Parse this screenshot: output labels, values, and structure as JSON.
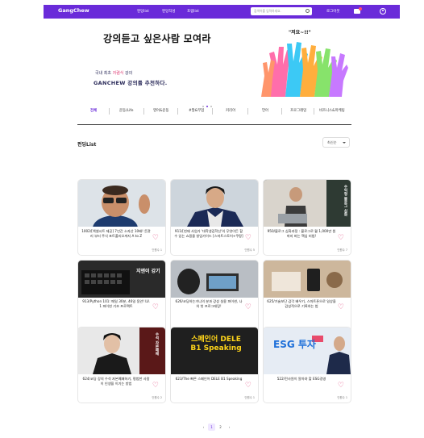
{
  "nav": {
    "logo": "GangChew",
    "links": [
      "펀딩list",
      "펀딩작성",
      "포럼list"
    ],
    "search_placeholder": "검색어를 입력하세요.",
    "login": "로그아웃"
  },
  "banner": {
    "title": "강의듣고 싶은사람 모여라",
    "line1_pre": "국내 최초",
    "line1_hl": "저렴식",
    "line1_post": "강의",
    "line2": "GANCHEW 강의를 추천하다.",
    "quote": "\"저요~!!\""
  },
  "categories": [
    "전체",
    "운동/Life",
    "영어&운동",
    "#많&부업",
    "커리어",
    "언어",
    "프로그래밍",
    "비즈니스&마케팅"
  ],
  "list_title": "펀딩List",
  "sort_label": "최신순",
  "cards": [
    {
      "title": "1002/[엑셀시트 제공] 7년간 소자산 10배! 돈관리 부터 주식 포트폴리오까지 A to Z",
      "count": "인원수 1",
      "thumb": "[3D avatar thumbnail]",
      "accent": "#dde3e8"
    },
    {
      "title": "911/[현재 사업가 '대학생김학신'의 무엇이든 할 수 있는 쇼핑몰 창업가이드 [스마트스토어+쿠팡]",
      "count": "인원수 5",
      "thumb": "[person photo]",
      "accent": "#cdd5dc"
    },
    {
      "title": "950/블로그 심화과정 : 블로그로 월 1,000만 원까지 버는 핵심 비법!",
      "count": "인원수 7",
      "thumb": "수익형 블로그 심화",
      "accent": "#2e3a33"
    },
    {
      "title": "913/Python 101: 매일 30분, 46일 동안! LV. 1 파이썬 기초 프로젝트",
      "count": "인원수 1",
      "thumb": "지엔이 강기",
      "accent": "#2a2a2a"
    },
    {
      "title": "626/코딩하는거니의 분과 강성 실용 파이썬, 나의 첫 프로그래밍!",
      "count": "인원수 3",
      "thumb": "[laptop photo]",
      "accent": "#9aa0a8"
    },
    {
      "title": "625/기술보단 감각 배우기, 스마트폰으로 일상을 감성적으로 기록하는 법",
      "count": "인원수 4",
      "thumb": "[desk photo]",
      "accent": "#c9b29a"
    },
    {
      "title": "624/코딩 강의 수석 자본예패하기, 평범한 사람이 인생을 이기는 방법",
      "count": "인원수 2",
      "thumb": "수석 자본예패",
      "accent": "#e8e8e8"
    },
    {
      "title": "623/The 빠른 스페인어 DELE B1 Speaking",
      "count": "인원수 1",
      "thumb": "스페인어 DELE B1 Speaking",
      "accent": "#1f1f1f"
    },
    {
      "title": "522/전사원이 알아야 할 ESG경영",
      "count": "인원수 1",
      "thumb": "ESG 투자",
      "accent": "#e9eef5"
    }
  ],
  "pagination": [
    "‹",
    "1",
    "2",
    "›"
  ],
  "colors": {
    "brand": "#6a2bd9",
    "heart": "#e0457b"
  }
}
